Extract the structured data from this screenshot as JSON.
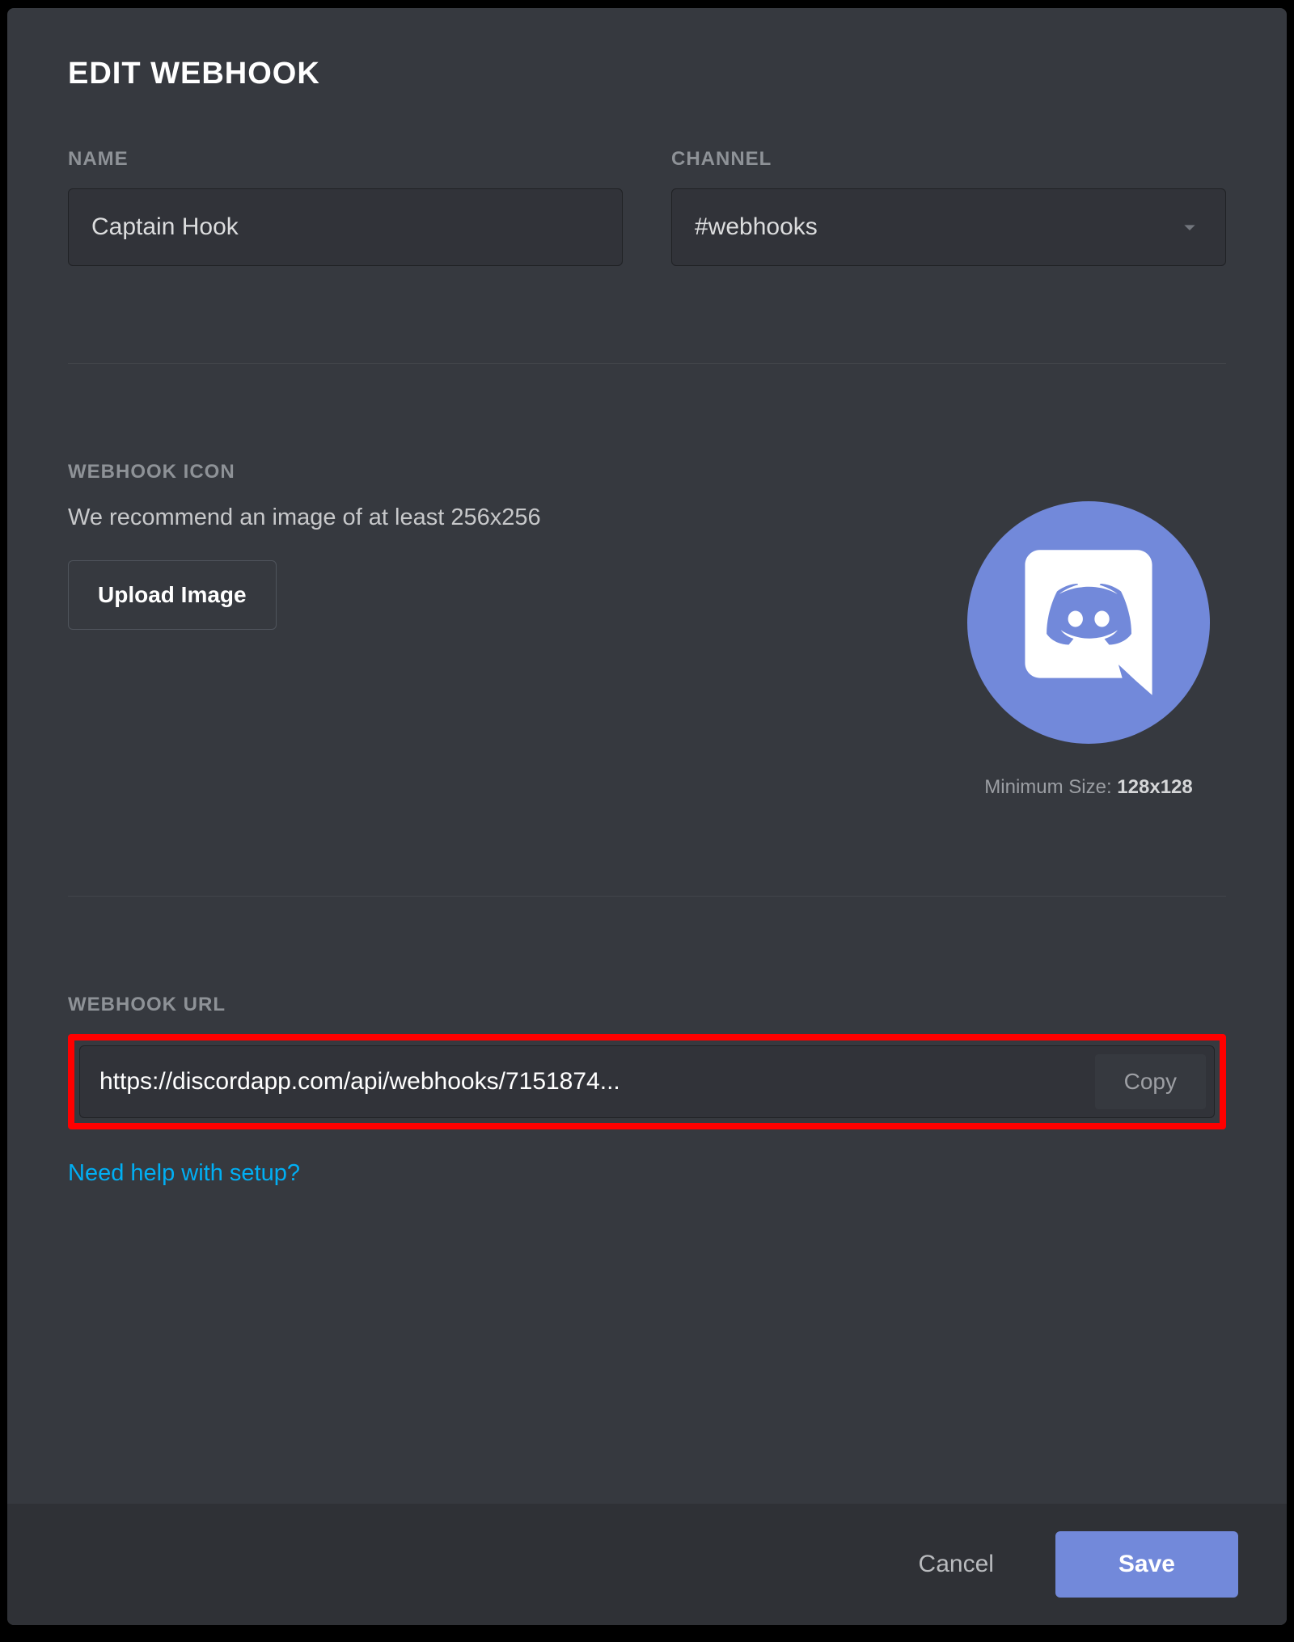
{
  "title": "EDIT WEBHOOK",
  "name": {
    "label": "NAME",
    "value": "Captain Hook"
  },
  "channel": {
    "label": "CHANNEL",
    "value": "#webhooks"
  },
  "icon": {
    "label": "WEBHOOK ICON",
    "hint": "We recommend an image of at least 256x256",
    "upload_label": "Upload Image",
    "min_size_prefix": "Minimum Size: ",
    "min_size_value": "128x128"
  },
  "url": {
    "label": "WEBHOOK URL",
    "value": "https://discordapp.com/api/webhooks/7151874...",
    "copy_label": "Copy"
  },
  "help_link": "Need help with setup?",
  "footer": {
    "cancel": "Cancel",
    "save": "Save"
  },
  "colors": {
    "accent": "#7289da",
    "link": "#00aff4",
    "highlight": "#ff0000"
  }
}
